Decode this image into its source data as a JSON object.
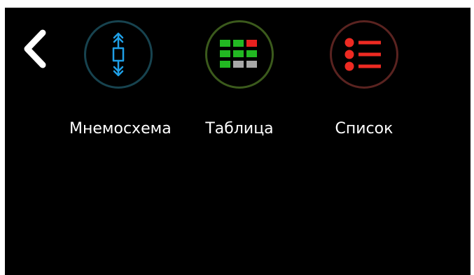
{
  "colors": {
    "background": "#000000",
    "text": "#ffffff",
    "mnemo_ring": "#17434f",
    "mnemo_icon": "#1f9fe6",
    "table_ring": "#3b5a1c",
    "table_green": "#22b822",
    "table_red": "#e8211f",
    "table_gray": "#a8a8a8",
    "list_ring": "#5a2320",
    "list_icon": "#ee2a22"
  },
  "nav": {
    "back_icon": "chevron-left-icon"
  },
  "menu": [
    {
      "id": "mnemo",
      "label": "Мнемосхема",
      "icon": "mnemonic-diagram-icon"
    },
    {
      "id": "table",
      "label": "Таблица",
      "icon": "table-grid-icon"
    },
    {
      "id": "list",
      "label": "Список",
      "icon": "bullet-list-icon"
    }
  ]
}
